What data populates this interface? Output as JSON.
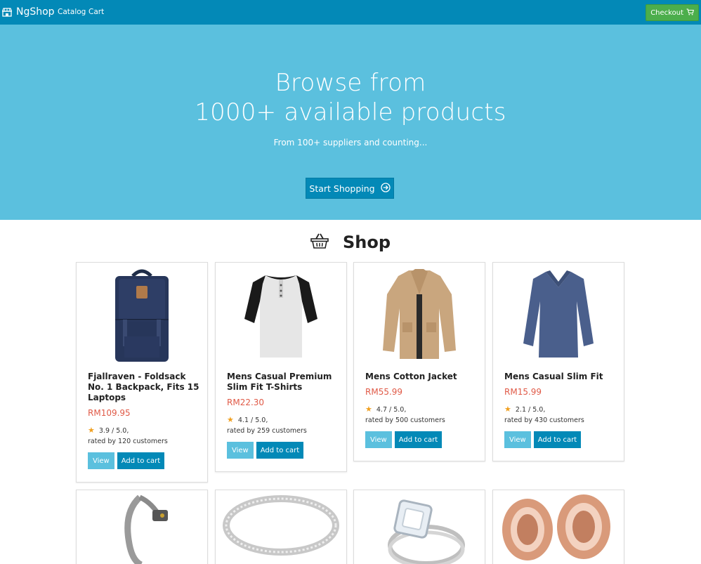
{
  "navbar": {
    "brand": "NgShop",
    "links": [
      "Catalog",
      "Cart"
    ],
    "checkout_label": "Checkout",
    "bg_color": "#0389b7"
  },
  "hero": {
    "line1": "Browse from",
    "line2": "1000+ available products",
    "subtitle": "From 100+ suppliers and counting...",
    "cta_label": "Start Shopping",
    "bg_color": "#5bc0de"
  },
  "shop": {
    "title": "Shop",
    "icon": "basket-icon"
  },
  "products": [
    {
      "title": "Fjallraven - Foldsack No. 1 Backpack, Fits 15 Laptops",
      "price": "RM109.95",
      "rating": "3.9 / 5.0,",
      "rated_by": "rated by 120 customers",
      "image": "backpack"
    },
    {
      "title": "Mens Casual Premium Slim Fit T-Shirts",
      "price": "RM22.30",
      "rating": "4.1 / 5.0,",
      "rated_by": "rated by 259 customers",
      "image": "raglan-shirt"
    },
    {
      "title": "Mens Cotton Jacket",
      "price": "RM55.99",
      "rating": "4.7 / 5.0,",
      "rated_by": "rated by 500 customers",
      "image": "jacket"
    },
    {
      "title": "Mens Casual Slim Fit",
      "price": "RM15.99",
      "rating": "2.1 / 5.0,",
      "rated_by": "rated by 430 customers",
      "image": "longsleeve"
    },
    {
      "title": "",
      "price": "",
      "rating": "",
      "rated_by": "",
      "image": "bracelet"
    },
    {
      "title": "",
      "price": "",
      "rating": "",
      "rated_by": "",
      "image": "ring"
    },
    {
      "title": "",
      "price": "",
      "rating": "",
      "rated_by": "",
      "image": "diamond-ring"
    },
    {
      "title": "",
      "price": "",
      "rating": "",
      "rated_by": "",
      "image": "plugs"
    }
  ],
  "buttons": {
    "view": "View",
    "add_to_cart": "Add to cart"
  },
  "colors": {
    "price": "#e05a47",
    "star": "#f0a020",
    "checkout": "#4cae4c"
  }
}
